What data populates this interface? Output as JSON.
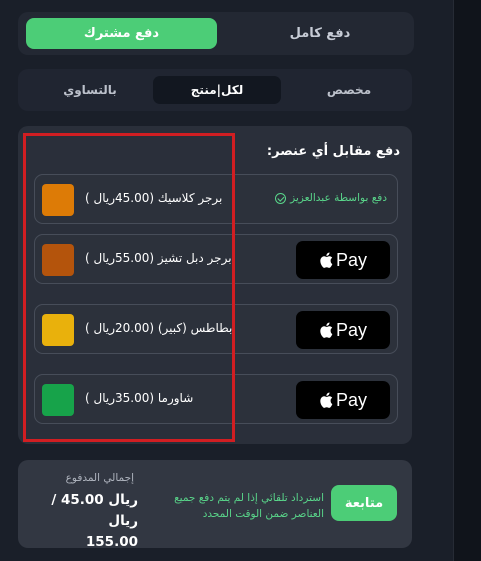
{
  "mode_tabs": {
    "shared": "دفع مشترك",
    "full": "دفع كامل"
  },
  "split_tabs": {
    "equal": "بالتساوي",
    "per_item": "لكل|منتج",
    "custom": "مخصص"
  },
  "item_card": {
    "title": "دفع مقابل أي عنصر:",
    "items": [
      {
        "label": "برجر كلاسيك (45.00ريال )",
        "color": "#dd7b06",
        "status_text": "دفع بواسطة عبدالعزيز",
        "action": null
      },
      {
        "label": "برجر دبل تشيز (55.00ريال )",
        "color": "#b4540c",
        "status_text": null,
        "action": "Pay"
      },
      {
        "label": "بطاطس (كبير) (20.00ريال )",
        "color": "#e9b10c",
        "status_text": null,
        "action": "Pay"
      },
      {
        "label": "شاورما (35.00ريال )",
        "color": "#17a34a",
        "status_text": null,
        "action": "Pay"
      }
    ]
  },
  "footer": {
    "continue_label": "متابعة",
    "refund_note": "استرداد تلقائي إذا لم يتم دفع جميع العناصر ضمن الوقت المحدد",
    "total_label": "إجمالي المدفوع",
    "total_value": "ريال 45.00 / ريال",
    "total_grand": "155.00"
  },
  "colors": {
    "accent": "#4ccd77",
    "highlight_border": "#d11e22"
  }
}
